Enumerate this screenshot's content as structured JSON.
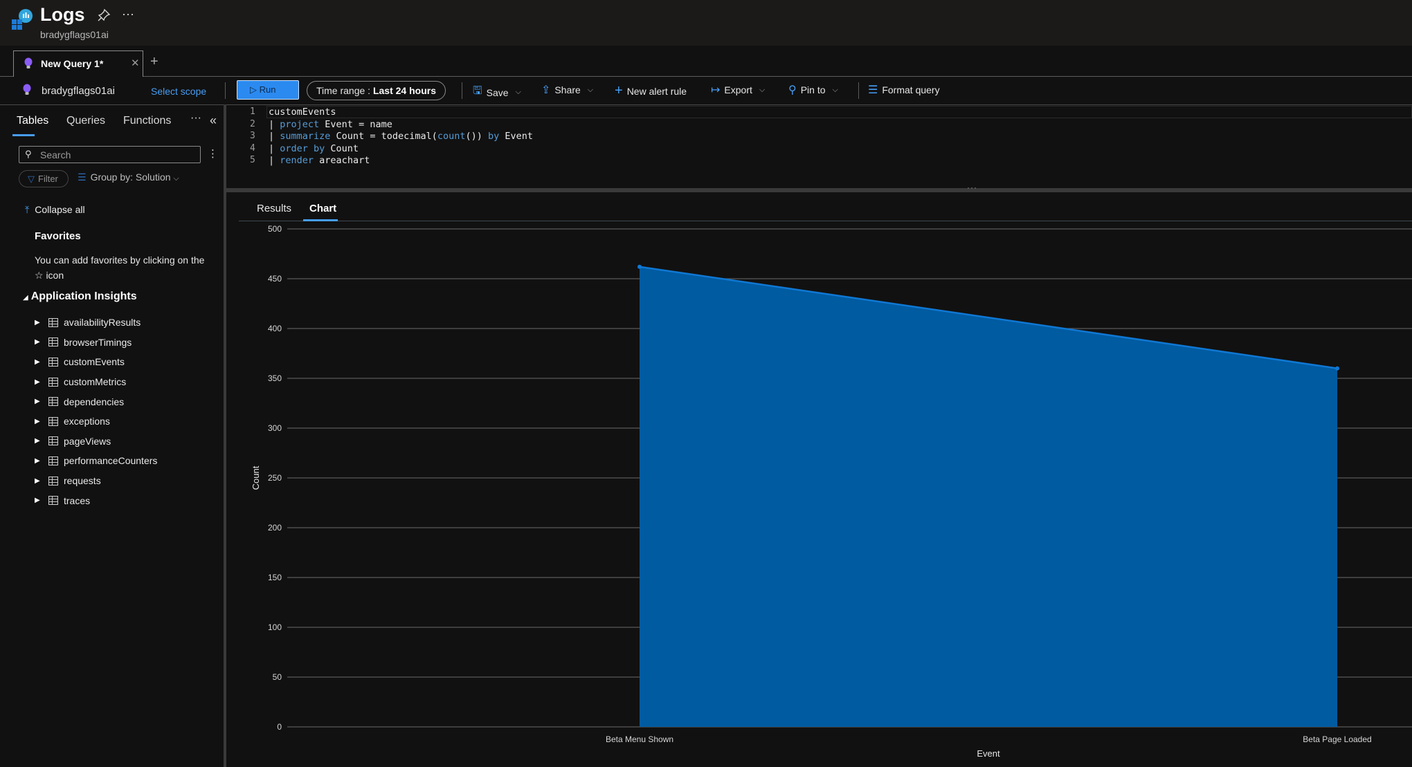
{
  "header": {
    "title": "Logs",
    "subtitle": "bradygflags01ai",
    "icons": [
      "app-insights-logs-icon",
      "pin-icon",
      "more-icon"
    ]
  },
  "tabs": {
    "items": [
      {
        "label": "New Query 1*",
        "icon": "lightbulb-icon",
        "active": true
      }
    ],
    "close_glyph": "✕",
    "add_glyph": "+"
  },
  "toolbar": {
    "scope_name": "bradygflags01ai",
    "select_scope": "Select scope",
    "run": "Run",
    "time_range_label": "Time range :",
    "time_range_value": "Last 24 hours",
    "save": "Save",
    "share": "Share",
    "new_alert_rule": "New alert rule",
    "export": "Export",
    "pin_to": "Pin to",
    "format_query": "Format query"
  },
  "sidebar": {
    "tabs": [
      "Tables",
      "Queries",
      "Functions"
    ],
    "active_tab": "Tables",
    "search_placeholder": "Search",
    "filter_label": "Filter",
    "group_by": "Group by: Solution",
    "collapse_all": "Collapse all",
    "favorites_title": "Favorites",
    "favorites_text": "You can add favorites by clicking on the ☆ icon",
    "group_title": "Application Insights",
    "tables": [
      "availabilityResults",
      "browserTimings",
      "customEvents",
      "customMetrics",
      "dependencies",
      "exceptions",
      "pageViews",
      "performanceCounters",
      "requests",
      "traces"
    ]
  },
  "editor": {
    "lines": [
      {
        "n": "1",
        "tokens": [
          {
            "t": "customEvents",
            "k": false
          }
        ]
      },
      {
        "n": "2",
        "tokens": [
          {
            "t": "| ",
            "k": false
          },
          {
            "t": "project",
            "k": true
          },
          {
            "t": " Event = name",
            "k": false
          }
        ]
      },
      {
        "n": "3",
        "tokens": [
          {
            "t": "| ",
            "k": false
          },
          {
            "t": "summarize",
            "k": true
          },
          {
            "t": " Count = todecimal(",
            "k": false
          },
          {
            "t": "count",
            "k": true
          },
          {
            "t": "()) ",
            "k": false
          },
          {
            "t": "by",
            "k": true
          },
          {
            "t": " Event",
            "k": false
          }
        ]
      },
      {
        "n": "4",
        "tokens": [
          {
            "t": "| ",
            "k": false
          },
          {
            "t": "order by",
            "k": true
          },
          {
            "t": " Count",
            "k": false
          }
        ]
      },
      {
        "n": "5",
        "tokens": [
          {
            "t": "| ",
            "k": false
          },
          {
            "t": "render",
            "k": true
          },
          {
            "t": " areachart",
            "k": false
          }
        ]
      }
    ]
  },
  "results": {
    "tabs": [
      "Results",
      "Chart"
    ],
    "active_tab": "Chart"
  },
  "colors": {
    "accent": "#479ef5",
    "area_fill": "#005ba1",
    "area_line": "#0f78d4",
    "grid": "#5a5a5a"
  },
  "chart_data": {
    "type": "area",
    "categories": [
      "Beta Menu Shown",
      "Beta Page Loaded"
    ],
    "series": [
      {
        "name": "Count",
        "values": [
          462,
          360
        ]
      }
    ],
    "xlabel": "Event",
    "ylabel": "Count",
    "ylim": [
      0,
      500
    ],
    "yticks": [
      0,
      50,
      100,
      150,
      200,
      250,
      300,
      350,
      400,
      450,
      500
    ],
    "grid": true,
    "legend": "none"
  }
}
